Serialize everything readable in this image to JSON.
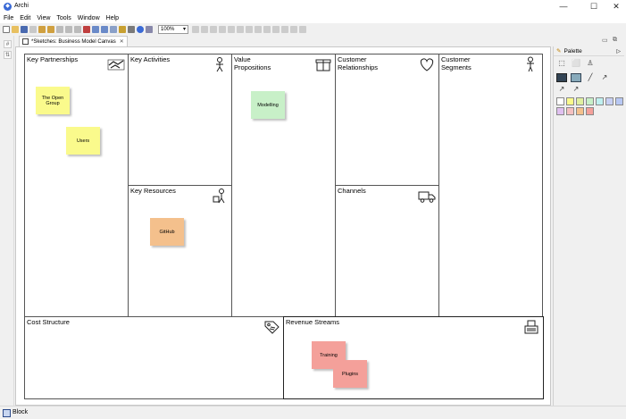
{
  "window": {
    "title": "Archi",
    "minimize": "—",
    "maximize": "☐",
    "close": "✕"
  },
  "menu": [
    "File",
    "Edit",
    "View",
    "Tools",
    "Window",
    "Help"
  ],
  "toolbar": {
    "zoom": "100%"
  },
  "editor": {
    "tab_title": "*Sketches: Business Model Canvas",
    "tab_close": "✕"
  },
  "canvas": {
    "key_partnerships": "Key Partnerships",
    "key_activities": "Key Activities",
    "key_resources": "Key Resources",
    "value_propositions": "Value\nPropositions",
    "customer_relationships": "Customer\nRelationships",
    "channels": "Channels",
    "customer_segments": "Customer\nSegments",
    "cost_structure": "Cost Structure",
    "revenue_streams": "Revenue Streams",
    "stickies": {
      "the_open_group": "The Open\nGroup",
      "users": "Users",
      "modelling": "Modelling",
      "github": "GitHub",
      "training": "Training",
      "plugins": "Plugins"
    }
  },
  "palette": {
    "title": "Palette",
    "expand": "▷"
  },
  "status": {
    "text": "Block"
  },
  "colors": {
    "yellow": "#fafa8c",
    "green": "#c8f0c8",
    "orange": "#f4c08c",
    "red": "#f4a09a"
  }
}
